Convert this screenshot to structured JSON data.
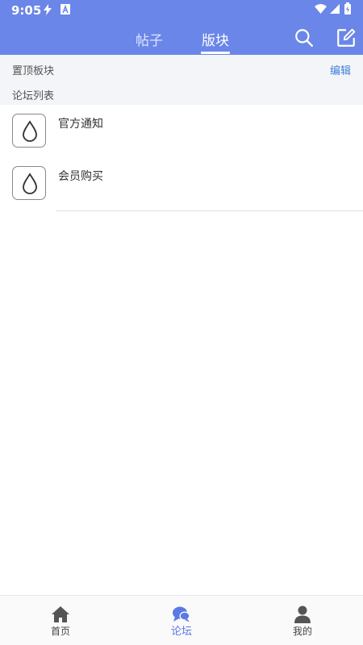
{
  "status_bar": {
    "time": "9:05",
    "icons": [
      "bolt-icon",
      "a-icon",
      "wifi-icon",
      "signal-icon",
      "battery-icon"
    ]
  },
  "header": {
    "tabs": [
      {
        "label": "帖子",
        "active": false
      },
      {
        "label": "版块",
        "active": true
      }
    ],
    "actions": [
      "search-icon",
      "compose-icon"
    ],
    "bg_color": "#6a86e8"
  },
  "pinned": {
    "label": "置顶板块",
    "edit_label": "编辑"
  },
  "forum_list": {
    "label": "论坛列表",
    "items": [
      {
        "name": "官方通知",
        "icon": "drop-icon"
      },
      {
        "name": "会员购买",
        "icon": "drop-icon"
      }
    ]
  },
  "bottom_nav": {
    "items": [
      {
        "label": "首页",
        "icon": "home-icon",
        "active": false
      },
      {
        "label": "论坛",
        "icon": "chat-bubbles-icon",
        "active": true
      },
      {
        "label": "我的",
        "icon": "user-icon",
        "active": false
      }
    ],
    "accent": "#5b7ae6"
  }
}
